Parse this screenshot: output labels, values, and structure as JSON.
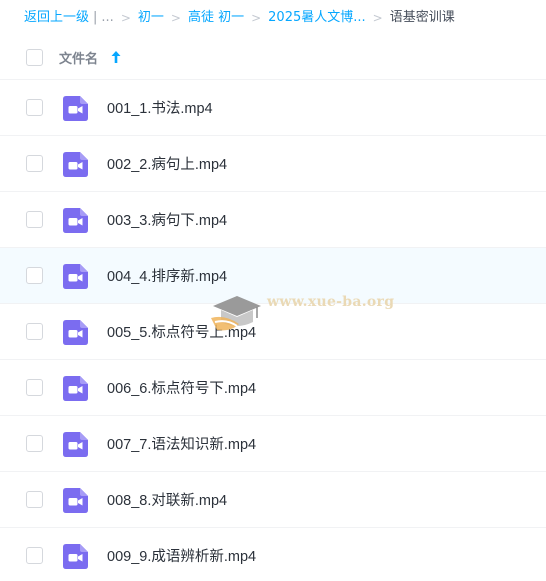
{
  "breadcrumb": {
    "back": "返回上一级",
    "divider": "|",
    "ellipsis": "...",
    "items": [
      "初一",
      "高徒 初一",
      "2025暑人文博..."
    ],
    "current": "语基密训课",
    "separator": ">"
  },
  "header": {
    "column_label": "文件名",
    "sort_icon": "arrow-up-icon"
  },
  "files": [
    {
      "name": "001_1.书法.mp4"
    },
    {
      "name": "002_2.病句上.mp4"
    },
    {
      "name": "003_3.病句下.mp4"
    },
    {
      "name": "004_4.排序新.mp4"
    },
    {
      "name": "005_5.标点符号上.mp4"
    },
    {
      "name": "006_6.标点符号下.mp4"
    },
    {
      "name": "007_7.语法知识新.mp4"
    },
    {
      "name": "008_8.对联新.mp4"
    },
    {
      "name": "009_9.成语辨析新.mp4"
    }
  ],
  "watermark": {
    "text": "www.xue-ba.org",
    "icon": "graduation-cap-icon"
  },
  "colors": {
    "link": "#06a7ff",
    "video_icon": "#7b6cf0",
    "hover_row": "#f4fbff"
  }
}
